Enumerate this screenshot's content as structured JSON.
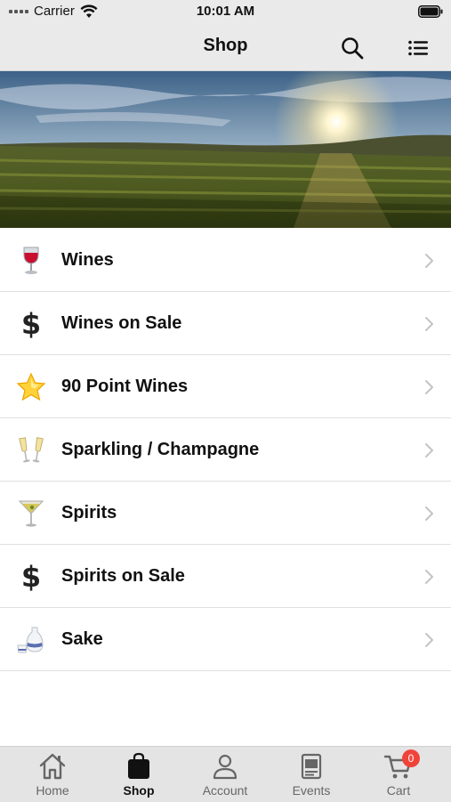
{
  "status_bar": {
    "carrier": "Carrier",
    "time": "10:01 AM"
  },
  "nav": {
    "title": "Shop",
    "search_icon": "search-icon",
    "list_icon": "list-icon"
  },
  "menu": {
    "items": [
      {
        "label": "Wines",
        "icon": "wine-glass-icon"
      },
      {
        "label": "Wines on Sale",
        "icon": "dollar-icon",
        "glyph": "$"
      },
      {
        "label": "90 Point Wines",
        "icon": "star-icon"
      },
      {
        "label": "Sparkling / Champagne",
        "icon": "champagne-glasses-icon"
      },
      {
        "label": "Spirits",
        "icon": "cocktail-glass-icon"
      },
      {
        "label": "Spirits on Sale",
        "icon": "dollar-icon",
        "glyph": "$"
      },
      {
        "label": "Sake",
        "icon": "sake-bottle-icon"
      }
    ]
  },
  "tabs": [
    {
      "label": "Home",
      "icon": "home-icon"
    },
    {
      "label": "Shop",
      "icon": "shopping-bag-icon",
      "active": true
    },
    {
      "label": "Account",
      "icon": "person-icon"
    },
    {
      "label": "Events",
      "icon": "calendar-icon"
    },
    {
      "label": "Cart",
      "icon": "cart-icon",
      "badge": "0"
    }
  ],
  "colors": {
    "bar_background": "#eaeaea",
    "badge": "#f0443a",
    "text": "#111111",
    "inactive_tab_text": "#666666"
  }
}
